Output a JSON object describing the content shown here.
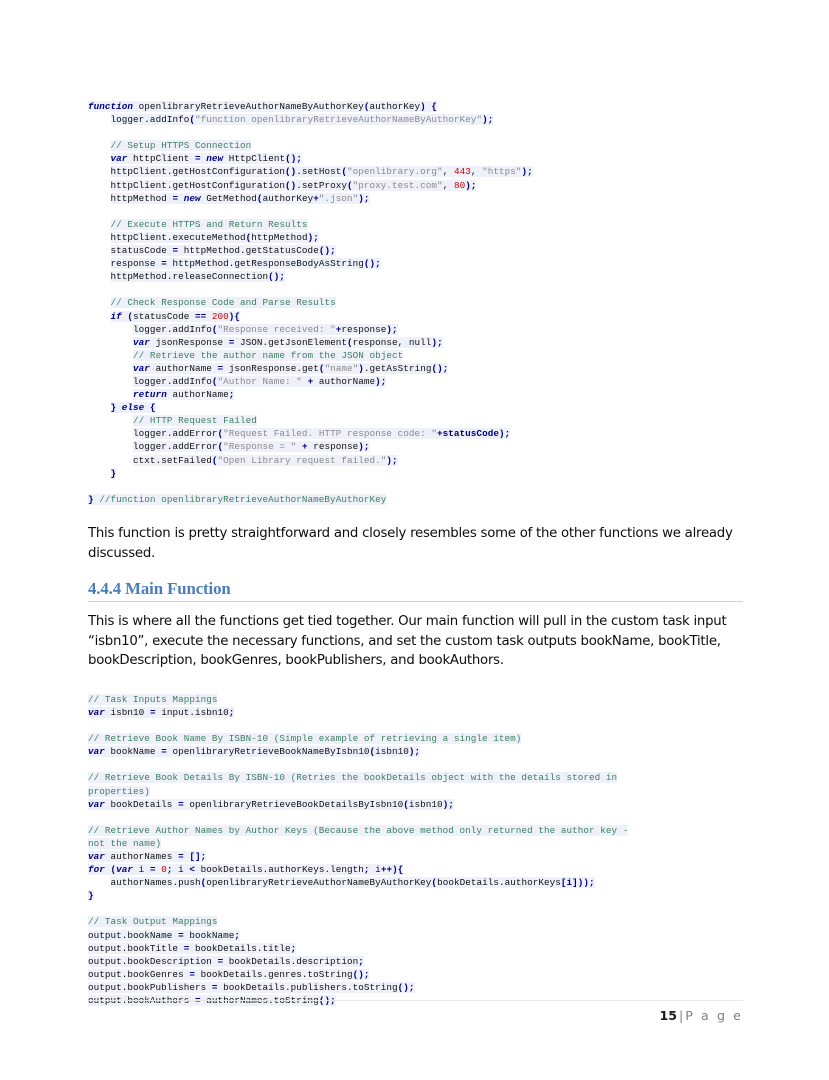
{
  "document": {
    "page_number": "15",
    "page_label": "P a g e",
    "page_separator": "|",
    "heading": "4.4.4 Main Function",
    "paragraph_1": "This function is pretty straightforward and closely resembles some of the other functions we already discussed.",
    "paragraph_2": "This is where all the functions get tied together. Our main function will pull in the custom task input “isbn10”, execute the necessary functions, and set the custom task outputs bookName, bookTitle, bookDescription, bookGenres, bookPublishers, and bookAuthors."
  },
  "colors": {
    "heading_blue": "#4a7ebb",
    "code_background": "#eef1fa",
    "keyword_navy": "#000080",
    "comment_green": "#3f7f5f",
    "string_gray": "#8a8a8a",
    "number_red": "#cc0000",
    "footer_gray": "#7f7f7f"
  },
  "code_block_1": {
    "name": "openlibraryRetrieveAuthorNameByAuthorKey function listing",
    "lines": [
      [
        {
          "t": "function",
          "c": "kw"
        },
        {
          "t": " openlibraryRetrieveAuthorNameByAuthorKey",
          "c": "pln"
        },
        {
          "t": "(",
          "c": "pun"
        },
        {
          "t": "authorKey",
          "c": "pln"
        },
        {
          "t": ") {",
          "c": "pun"
        }
      ],
      [
        {
          "t": "    logger.addInfo",
          "c": "pln"
        },
        {
          "t": "(",
          "c": "pun"
        },
        {
          "t": "\"function openlibraryRetrieveAuthorNameByAuthorKey\"",
          "c": "str"
        },
        {
          "t": ");",
          "c": "pun"
        }
      ],
      [],
      [
        {
          "t": "    // Setup HTTPS Connection",
          "c": "cmt"
        }
      ],
      [
        {
          "t": "    ",
          "c": "pln"
        },
        {
          "t": "var",
          "c": "kw"
        },
        {
          "t": " httpClient ",
          "c": "pln"
        },
        {
          "t": "=",
          "c": "pun"
        },
        {
          "t": " ",
          "c": "pln"
        },
        {
          "t": "new",
          "c": "kw"
        },
        {
          "t": " HttpClient",
          "c": "pln"
        },
        {
          "t": "();",
          "c": "pun"
        }
      ],
      [
        {
          "t": "    httpClient.getHostConfiguration",
          "c": "pln"
        },
        {
          "t": "()",
          "c": "pun"
        },
        {
          "t": ".setHost",
          "c": "pln"
        },
        {
          "t": "(",
          "c": "pun"
        },
        {
          "t": "\"openlibrary.org\"",
          "c": "str"
        },
        {
          "t": ", ",
          "c": "pln"
        },
        {
          "t": "443",
          "c": "num"
        },
        {
          "t": ", ",
          "c": "pln"
        },
        {
          "t": "\"https\"",
          "c": "str"
        },
        {
          "t": ");",
          "c": "pun"
        }
      ],
      [
        {
          "t": "    httpClient.getHostConfiguration",
          "c": "pln"
        },
        {
          "t": "()",
          "c": "pun"
        },
        {
          "t": ".setProxy",
          "c": "pln"
        },
        {
          "t": "(",
          "c": "pun"
        },
        {
          "t": "\"proxy.test.com\"",
          "c": "str"
        },
        {
          "t": ", ",
          "c": "pln"
        },
        {
          "t": "80",
          "c": "num"
        },
        {
          "t": ");",
          "c": "pun"
        }
      ],
      [
        {
          "t": "    httpMethod ",
          "c": "pln"
        },
        {
          "t": "=",
          "c": "pun"
        },
        {
          "t": " ",
          "c": "pln"
        },
        {
          "t": "new",
          "c": "kw"
        },
        {
          "t": " GetMethod",
          "c": "pln"
        },
        {
          "t": "(",
          "c": "pun"
        },
        {
          "t": "authorKey",
          "c": "pln"
        },
        {
          "t": "+",
          "c": "pun"
        },
        {
          "t": "\".json\"",
          "c": "str"
        },
        {
          "t": ");",
          "c": "pun"
        }
      ],
      [],
      [
        {
          "t": "    // Execute HTTPS and Return Results",
          "c": "cmt"
        }
      ],
      [
        {
          "t": "    httpClient.executeMethod",
          "c": "pln"
        },
        {
          "t": "(",
          "c": "pun"
        },
        {
          "t": "httpMethod",
          "c": "pln"
        },
        {
          "t": ");",
          "c": "pun"
        }
      ],
      [
        {
          "t": "    statusCode ",
          "c": "pln"
        },
        {
          "t": "=",
          "c": "pun"
        },
        {
          "t": " httpMethod.getStatusCode",
          "c": "pln"
        },
        {
          "t": "();",
          "c": "pun"
        }
      ],
      [
        {
          "t": "    response ",
          "c": "pln"
        },
        {
          "t": "=",
          "c": "pun"
        },
        {
          "t": " httpMethod.getResponseBodyAsString",
          "c": "pln"
        },
        {
          "t": "();",
          "c": "pun"
        }
      ],
      [
        {
          "t": "    httpMethod.releaseConnection",
          "c": "pln"
        },
        {
          "t": "();",
          "c": "pun"
        }
      ],
      [],
      [
        {
          "t": "    // Check Response Code and Parse Results",
          "c": "cmt"
        }
      ],
      [
        {
          "t": "    ",
          "c": "pln"
        },
        {
          "t": "if",
          "c": "kw"
        },
        {
          "t": " (",
          "c": "pun"
        },
        {
          "t": "statusCode ",
          "c": "pln"
        },
        {
          "t": "==",
          "c": "pun"
        },
        {
          "t": " ",
          "c": "pln"
        },
        {
          "t": "200",
          "c": "num"
        },
        {
          "t": "){",
          "c": "pun"
        }
      ],
      [
        {
          "t": "        logger.addInfo",
          "c": "pln"
        },
        {
          "t": "(",
          "c": "pun"
        },
        {
          "t": "\"Response received: \"",
          "c": "str"
        },
        {
          "t": "+",
          "c": "pun"
        },
        {
          "t": "response",
          "c": "pln"
        },
        {
          "t": ");",
          "c": "pun"
        }
      ],
      [
        {
          "t": "        ",
          "c": "pln"
        },
        {
          "t": "var",
          "c": "kw"
        },
        {
          "t": " jsonResponse ",
          "c": "pln"
        },
        {
          "t": "=",
          "c": "pun"
        },
        {
          "t": " JSON.getJsonElement",
          "c": "pln"
        },
        {
          "t": "(",
          "c": "pun"
        },
        {
          "t": "response, null",
          "c": "pln"
        },
        {
          "t": ");",
          "c": "pun"
        }
      ],
      [
        {
          "t": "        // Retrieve the author name from the JSON object",
          "c": "cmt"
        }
      ],
      [
        {
          "t": "        ",
          "c": "pln"
        },
        {
          "t": "var",
          "c": "kw"
        },
        {
          "t": " authorName ",
          "c": "pln"
        },
        {
          "t": "=",
          "c": "pun"
        },
        {
          "t": " jsonResponse.get",
          "c": "pln"
        },
        {
          "t": "(",
          "c": "pun"
        },
        {
          "t": "\"name\"",
          "c": "str"
        },
        {
          "t": ")",
          "c": "pun"
        },
        {
          "t": ".getAsString",
          "c": "pln"
        },
        {
          "t": "();",
          "c": "pun"
        }
      ],
      [
        {
          "t": "        logger.addInfo",
          "c": "pln"
        },
        {
          "t": "(",
          "c": "pun"
        },
        {
          "t": "\"Author Name: \"",
          "c": "str"
        },
        {
          "t": " ",
          "c": "pln"
        },
        {
          "t": "+",
          "c": "pun"
        },
        {
          "t": " authorName",
          "c": "pln"
        },
        {
          "t": ");",
          "c": "pun"
        }
      ],
      [
        {
          "t": "        ",
          "c": "pln"
        },
        {
          "t": "return",
          "c": "kw"
        },
        {
          "t": " authorName",
          "c": "pln"
        },
        {
          "t": ";",
          "c": "pun"
        }
      ],
      [
        {
          "t": "    } ",
          "c": "pun"
        },
        {
          "t": "else",
          "c": "kw"
        },
        {
          "t": " {",
          "c": "pun"
        }
      ],
      [
        {
          "t": "        // HTTP Request Failed",
          "c": "cmt"
        }
      ],
      [
        {
          "t": "        logger.addError",
          "c": "pln"
        },
        {
          "t": "(",
          "c": "pun"
        },
        {
          "t": "\"Request Failed. HTTP response code: \"",
          "c": "str"
        },
        {
          "t": "+statusCode",
          "c": "pun"
        },
        {
          "t": ");",
          "c": "pun"
        }
      ],
      [
        {
          "t": "        logger.addError",
          "c": "pln"
        },
        {
          "t": "(",
          "c": "pun"
        },
        {
          "t": "\"Response = \"",
          "c": "str"
        },
        {
          "t": " ",
          "c": "pln"
        },
        {
          "t": "+",
          "c": "pun"
        },
        {
          "t": " response",
          "c": "pln"
        },
        {
          "t": ");",
          "c": "pun"
        }
      ],
      [
        {
          "t": "        ctxt.setFailed",
          "c": "pln"
        },
        {
          "t": "(",
          "c": "pun"
        },
        {
          "t": "\"Open Library request failed.\"",
          "c": "str"
        },
        {
          "t": ");",
          "c": "pun"
        }
      ],
      [
        {
          "t": "    }",
          "c": "pun"
        }
      ],
      [],
      [
        {
          "t": "}",
          "c": "pun"
        },
        {
          "t": " //function openlibraryRetrieveAuthorNameByAuthorKey",
          "c": "cmt"
        }
      ]
    ]
  },
  "code_block_2": {
    "name": "main function listing",
    "lines": [
      [
        {
          "t": "// Task Inputs Mappings",
          "c": "cmt"
        }
      ],
      [
        {
          "t": "var",
          "c": "kw"
        },
        {
          "t": " isbn10 ",
          "c": "pln"
        },
        {
          "t": "=",
          "c": "pun"
        },
        {
          "t": " input.isbn10",
          "c": "pln"
        },
        {
          "t": ";",
          "c": "pun"
        }
      ],
      [],
      [
        {
          "t": "// Retrieve Book Name By ISBN-10 (Simple example of retrieving a single item)",
          "c": "cmt"
        }
      ],
      [
        {
          "t": "var",
          "c": "kw"
        },
        {
          "t": " bookName ",
          "c": "pln"
        },
        {
          "t": "=",
          "c": "pun"
        },
        {
          "t": " openlibraryRetrieveBookNameByIsbn10",
          "c": "pln"
        },
        {
          "t": "(",
          "c": "pun"
        },
        {
          "t": "isbn10",
          "c": "pln"
        },
        {
          "t": ");",
          "c": "pun"
        }
      ],
      [],
      [
        {
          "t": "// Retrieve Book Details By ISBN-10 (Retries the bookDetails object with the details stored in",
          "c": "cmt"
        }
      ],
      [
        {
          "t": "properties)",
          "c": "cmt"
        }
      ],
      [
        {
          "t": "var",
          "c": "kw"
        },
        {
          "t": " bookDetails ",
          "c": "pln"
        },
        {
          "t": "=",
          "c": "pun"
        },
        {
          "t": " openlibraryRetrieveBookDetailsByIsbn10",
          "c": "pln"
        },
        {
          "t": "(",
          "c": "pun"
        },
        {
          "t": "isbn10",
          "c": "pln"
        },
        {
          "t": ");",
          "c": "pun"
        }
      ],
      [],
      [
        {
          "t": "// Retrieve Author Names by Author Keys (Because the above method only returned the author key -",
          "c": "cmt"
        }
      ],
      [
        {
          "t": "not the name)",
          "c": "cmt"
        }
      ],
      [
        {
          "t": "var",
          "c": "kw"
        },
        {
          "t": " authorNames ",
          "c": "pln"
        },
        {
          "t": "=",
          "c": "pun"
        },
        {
          "t": " ",
          "c": "pln"
        },
        {
          "t": "[];",
          "c": "pun"
        }
      ],
      [
        {
          "t": "for",
          "c": "kw"
        },
        {
          "t": " (",
          "c": "pun"
        },
        {
          "t": "var",
          "c": "kw"
        },
        {
          "t": " i ",
          "c": "pln"
        },
        {
          "t": "=",
          "c": "pun"
        },
        {
          "t": " ",
          "c": "pln"
        },
        {
          "t": "0",
          "c": "num"
        },
        {
          "t": "; ",
          "c": "pun"
        },
        {
          "t": "i ",
          "c": "pln"
        },
        {
          "t": "<",
          "c": "pun"
        },
        {
          "t": " bookDetails.authorKeys.length",
          "c": "pln"
        },
        {
          "t": "; ",
          "c": "pun"
        },
        {
          "t": "i",
          "c": "pln"
        },
        {
          "t": "++){",
          "c": "pun"
        }
      ],
      [
        {
          "t": "    authorNames.push",
          "c": "pln"
        },
        {
          "t": "(",
          "c": "pun"
        },
        {
          "t": "openlibraryRetrieveAuthorNameByAuthorKey",
          "c": "pln"
        },
        {
          "t": "(",
          "c": "pun"
        },
        {
          "t": "bookDetails.authorKeys",
          "c": "pln"
        },
        {
          "t": "[i]));",
          "c": "pun"
        }
      ],
      [
        {
          "t": "}",
          "c": "pun"
        }
      ],
      [],
      [
        {
          "t": "// Task Output Mappings",
          "c": "cmt"
        }
      ],
      [
        {
          "t": "output.bookName ",
          "c": "pln"
        },
        {
          "t": "=",
          "c": "pun"
        },
        {
          "t": " bookName",
          "c": "pln"
        },
        {
          "t": ";",
          "c": "pun"
        }
      ],
      [
        {
          "t": "output.bookTitle ",
          "c": "pln"
        },
        {
          "t": "=",
          "c": "pun"
        },
        {
          "t": " bookDetails.title",
          "c": "pln"
        },
        {
          "t": ";",
          "c": "pun"
        }
      ],
      [
        {
          "t": "output.bookDescription ",
          "c": "pln"
        },
        {
          "t": "=",
          "c": "pun"
        },
        {
          "t": " bookDetails.description",
          "c": "pln"
        },
        {
          "t": ";",
          "c": "pun"
        }
      ],
      [
        {
          "t": "output.bookGenres ",
          "c": "pln"
        },
        {
          "t": "=",
          "c": "pun"
        },
        {
          "t": " bookDetails.genres.toString",
          "c": "pln"
        },
        {
          "t": "();",
          "c": "pun"
        }
      ],
      [
        {
          "t": "output.bookPublishers ",
          "c": "pln"
        },
        {
          "t": "=",
          "c": "pun"
        },
        {
          "t": " bookDetails.publishers.toString",
          "c": "pln"
        },
        {
          "t": "();",
          "c": "pun"
        }
      ],
      [
        {
          "t": "output.bookAuthors ",
          "c": "pln"
        },
        {
          "t": "=",
          "c": "pun"
        },
        {
          "t": " authorNames.toString",
          "c": "pln"
        },
        {
          "t": "();",
          "c": "pun"
        }
      ]
    ]
  }
}
